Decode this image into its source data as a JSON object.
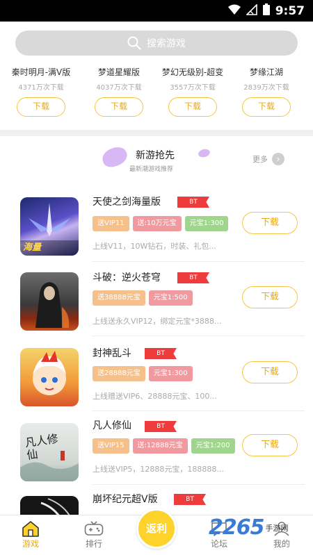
{
  "status_bar": {
    "time": "9:57"
  },
  "search": {
    "placeholder": "搜索游戏"
  },
  "top_games": [
    {
      "name": "秦时明月-满V版",
      "downloads": "4371万次下载",
      "button": "下载"
    },
    {
      "name": "梦道星耀版",
      "downloads": "4037万次下载",
      "button": "下载"
    },
    {
      "name": "梦幻无级别-超变",
      "downloads": "3557万次下载",
      "button": "下载"
    },
    {
      "name": "梦缘江湖",
      "downloads": "2839万次下载",
      "button": "下载"
    }
  ],
  "section": {
    "title": "新游抢先",
    "subtitle": "最新潮游戏推荐",
    "more": "更多"
  },
  "games": [
    {
      "name": "天使之剑海量版",
      "badge": "BT",
      "tags": [
        "送VIP11",
        "送:10万元宝",
        "元宝1:300"
      ],
      "desc": "上线V11，10W钻石，时装、礼包...",
      "button": "下载",
      "thumb_label": "海量"
    },
    {
      "name": "斗破：逆火苍穹",
      "badge": "BT",
      "tags": [
        "送38888元宝",
        "元宝1:500"
      ],
      "desc": "上线送永久VIP12，绑定元宝*3888...",
      "button": "下载"
    },
    {
      "name": "封神乱斗",
      "badge": "BT",
      "tags": [
        "送28888元宝",
        "元宝1:300"
      ],
      "desc": "上线赠送VIP6、28888元宝、100...",
      "button": "下载"
    },
    {
      "name": "凡人修仙",
      "badge": "BT",
      "tags": [
        "送VIP15",
        "送:12888元宝",
        "元宝1:200"
      ],
      "desc": "上线送VIP5，12888元宝，188888...",
      "button": "下载",
      "thumb_label": "凡人修仙"
    },
    {
      "name": "崩坏纪元超V版",
      "badge": "BT",
      "tags": [],
      "desc": "",
      "button": ""
    }
  ],
  "nav": {
    "games": "游戏",
    "rank": "排行",
    "fab": "返利",
    "forum": "论坛",
    "mine": "我的"
  },
  "watermark": {
    "number": "2265",
    "text": "手游网"
  },
  "colors": {
    "accent": "#f5c543",
    "badge": "#ee3b3b"
  }
}
